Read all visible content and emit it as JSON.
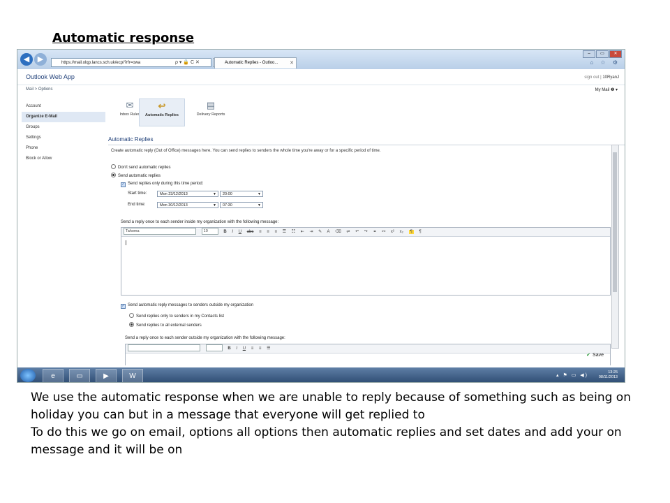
{
  "slide": {
    "title": "Automatic response",
    "paragraphs": [
      "We use the automatic response when we are unable to reply because of something such as being on holiday you can but in a message that everyone will get replied to",
      "To do this we go on email, options all options then automatic replies and set dates and add your on message and it will be on"
    ]
  },
  "browser": {
    "url": "https://mail.olqp.lancs.sch.uk/ecp/?rfr=owa",
    "address_controls": "ρ ▾ 🔒 C ✕",
    "tab_title": "Automatic Replies - Outloo...",
    "tab_close": "✕",
    "window_buttons": [
      "‒",
      "▭",
      "✕"
    ],
    "toolbar_icons": "⌂ ☆ ⚙"
  },
  "owa": {
    "app_name": "Outlook Web App",
    "sign_out": "sign out",
    "user": "10RyanJ",
    "breadcrumb": "Mail  >  Options",
    "my_mail": "My Mail",
    "help": "❷ ▾"
  },
  "leftnav": {
    "items": [
      "Account",
      "Organize E-Mail",
      "Groups",
      "Settings",
      "Phone",
      "Block or Allow"
    ]
  },
  "iconbar": {
    "items": [
      "Inbox Rules",
      "Automatic Replies",
      "Delivery Reports"
    ]
  },
  "form": {
    "section_title": "Automatic Replies",
    "description": "Create automatic reply (Out of Office) messages here. You can send replies to senders the whole time you're away or for a specific period of time.",
    "dont_send": "Don't send automatic replies",
    "send": "Send automatic replies",
    "time_period": "Send replies only during this time period:",
    "start_label": "Start time:",
    "start_date": "Mon 23/12/2013",
    "start_time": "20:00",
    "end_label": "End time:",
    "end_date": "Mon 30/12/2013",
    "end_time": "07:30",
    "inside_label": "Send a reply once to each sender inside my organization with the following message:",
    "font": "Tahoma",
    "size": "10",
    "outside_check": "Send automatic reply messages to senders outside my organization",
    "contacts_only": "Send replies only to senders in my Contacts list",
    "all_external": "Send replies to all external senders",
    "outside_label": "Send a reply once to each sender outside my organization with the following message:",
    "save": "Save"
  },
  "taskbar": {
    "time": "13:25",
    "date": "08/11/2013",
    "tray": "▴ ⚑ ▭ ◀)"
  }
}
